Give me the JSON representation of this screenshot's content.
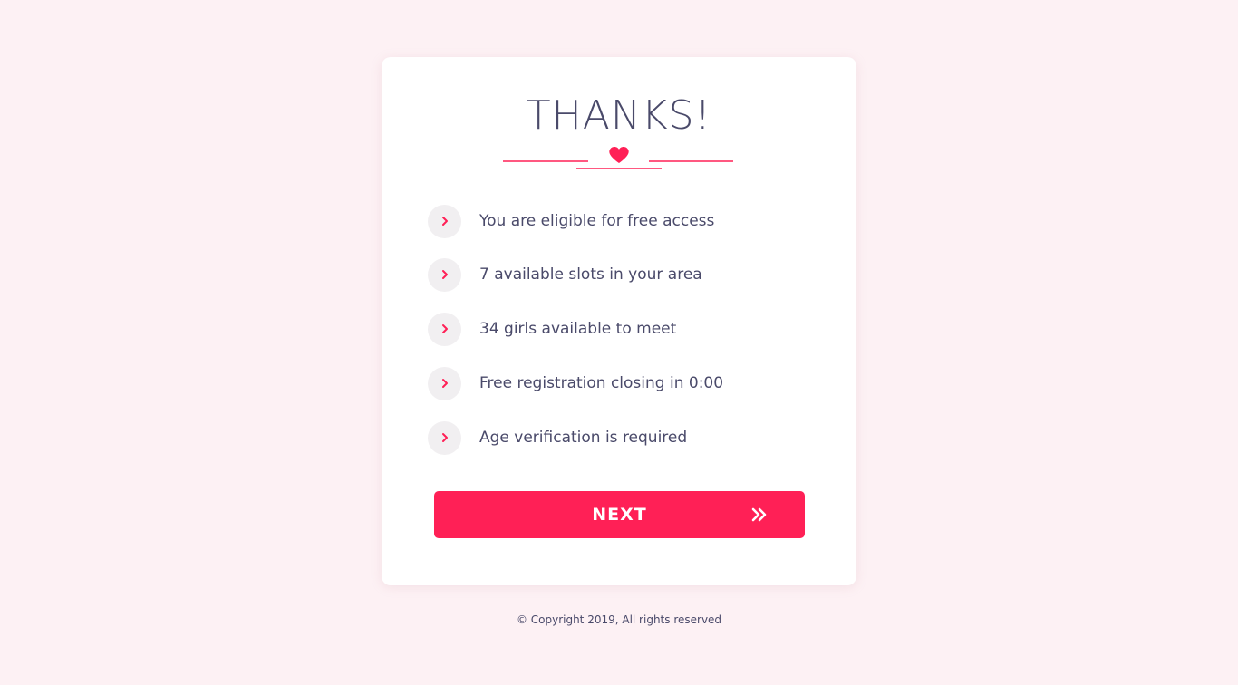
{
  "title": "THANKS!",
  "checklist": [
    {
      "icon": "chevron-right-icon",
      "text": "You are eligible for free access"
    },
    {
      "icon": "chevron-right-icon",
      "text": "7 available slots in your area"
    },
    {
      "icon": "chevron-right-icon",
      "text": "34 girls available to meet"
    },
    {
      "icon": "chevron-right-icon",
      "text": "Free registration closing in 0:00"
    },
    {
      "icon": "chevron-right-icon",
      "text": "Age verification is required"
    }
  ],
  "next_button": {
    "label": "NEXT",
    "icon": "double-chevron-right-icon"
  },
  "footer": {
    "copyright": "© Copyright 2019, All rights reserved"
  },
  "colors": {
    "accent": "#ff2056",
    "background": "#fdf1f4",
    "card": "#ffffff",
    "text": "#4a4a6a",
    "bullet_bg": "#f1eff1"
  }
}
